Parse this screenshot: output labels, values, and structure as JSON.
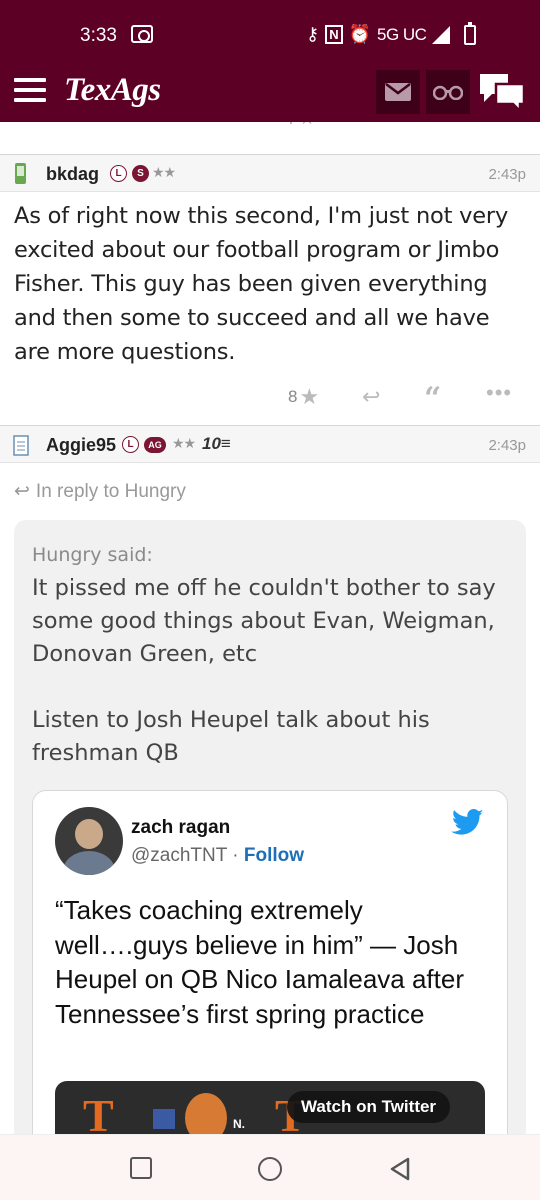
{
  "status_bar": {
    "time": "3:33",
    "network": "5G UC"
  },
  "app": {
    "logo": "TexAgs",
    "brand_color": "#5d0025"
  },
  "previous_post_actions": {
    "count": "4"
  },
  "posts": [
    {
      "username": "bkdag",
      "badge_l": "L",
      "badge_s": "S",
      "stars": "★★",
      "time": "2:43p",
      "body": "As of right now this second, I'm just not very excited about our football program or Jimbo Fisher. This guy has been given everything and then some to succeed and all we have are more questions.",
      "star_count": "8"
    },
    {
      "username": "Aggie95",
      "badge_l": "L",
      "badge_ag": "AG",
      "stars": "★★",
      "tenyear": "10",
      "time": "2:43p",
      "in_reply_to": "In reply to Hungry",
      "quote": {
        "attribution": "Hungry said:",
        "paragraph_1": "It pissed me off he couldn't bother to say some good things about Evan, Weigman, Donovan Green, etc",
        "paragraph_2": "Listen to Josh Heupel talk about his freshman QB"
      },
      "tweet": {
        "name": "zach ragan",
        "handle": "@zachTNT",
        "separator": "·",
        "follow": "Follow",
        "text": "“Takes coaching extremely well….guys believe in him” — Josh Heupel on QB Nico Iamaleava after Tennessee’s first spring practice",
        "watch_label": "Watch on Twitter",
        "media_text": "N."
      }
    }
  ]
}
